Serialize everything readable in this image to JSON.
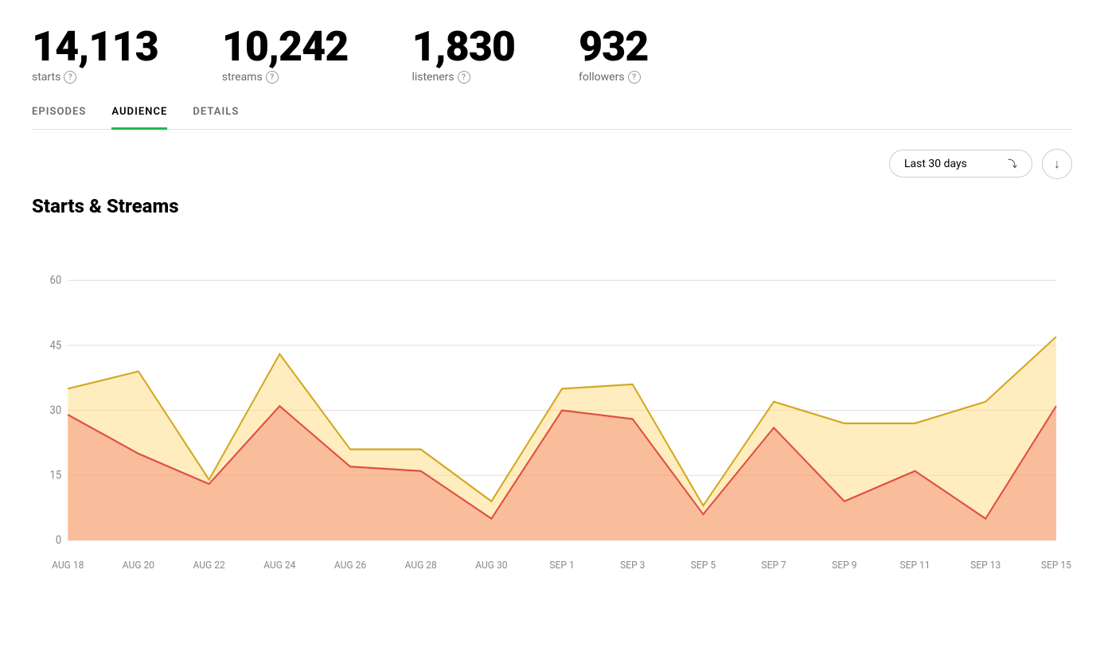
{
  "stats": [
    {
      "id": "starts",
      "value": "14,113",
      "label": "starts"
    },
    {
      "id": "streams",
      "value": "10,242",
      "label": "streams"
    },
    {
      "id": "listeners",
      "value": "1,830",
      "label": "listeners"
    },
    {
      "id": "followers",
      "value": "932",
      "label": "followers"
    }
  ],
  "tabs": [
    {
      "id": "episodes",
      "label": "EPISODES",
      "active": false
    },
    {
      "id": "audience",
      "label": "AUDIENCE",
      "active": true
    },
    {
      "id": "details",
      "label": "DETAILS",
      "active": false
    }
  ],
  "toolbar": {
    "date_range": "Last 30 days",
    "download_icon": "↓"
  },
  "chart": {
    "title": "Starts & Streams",
    "y_labels": [
      "0",
      "15",
      "30",
      "45",
      "60"
    ],
    "x_labels": [
      "AUG 18",
      "AUG 20",
      "AUG 22",
      "AUG 24",
      "AUG 26",
      "AUG 28",
      "AUG 30",
      "SEP 1",
      "SEP 3",
      "SEP 5",
      "SEP 7",
      "SEP 9",
      "SEP 11",
      "SEP 13",
      "SEP 15"
    ],
    "starts_data": [
      29,
      20,
      13,
      31,
      17,
      16,
      5,
      30,
      28,
      6,
      26,
      9,
      16,
      5,
      31
    ],
    "streams_data": [
      35,
      39,
      14,
      43,
      21,
      21,
      9,
      35,
      36,
      8,
      32,
      27,
      27,
      32,
      47
    ],
    "colors": {
      "starts_fill": "rgba(255, 120, 100, 0.35)",
      "starts_line": "#e05a4e",
      "streams_fill": "rgba(255, 220, 120, 0.45)",
      "streams_line": "#e8c050",
      "grid_line": "#e8e8e8",
      "label_color": "#888"
    }
  }
}
